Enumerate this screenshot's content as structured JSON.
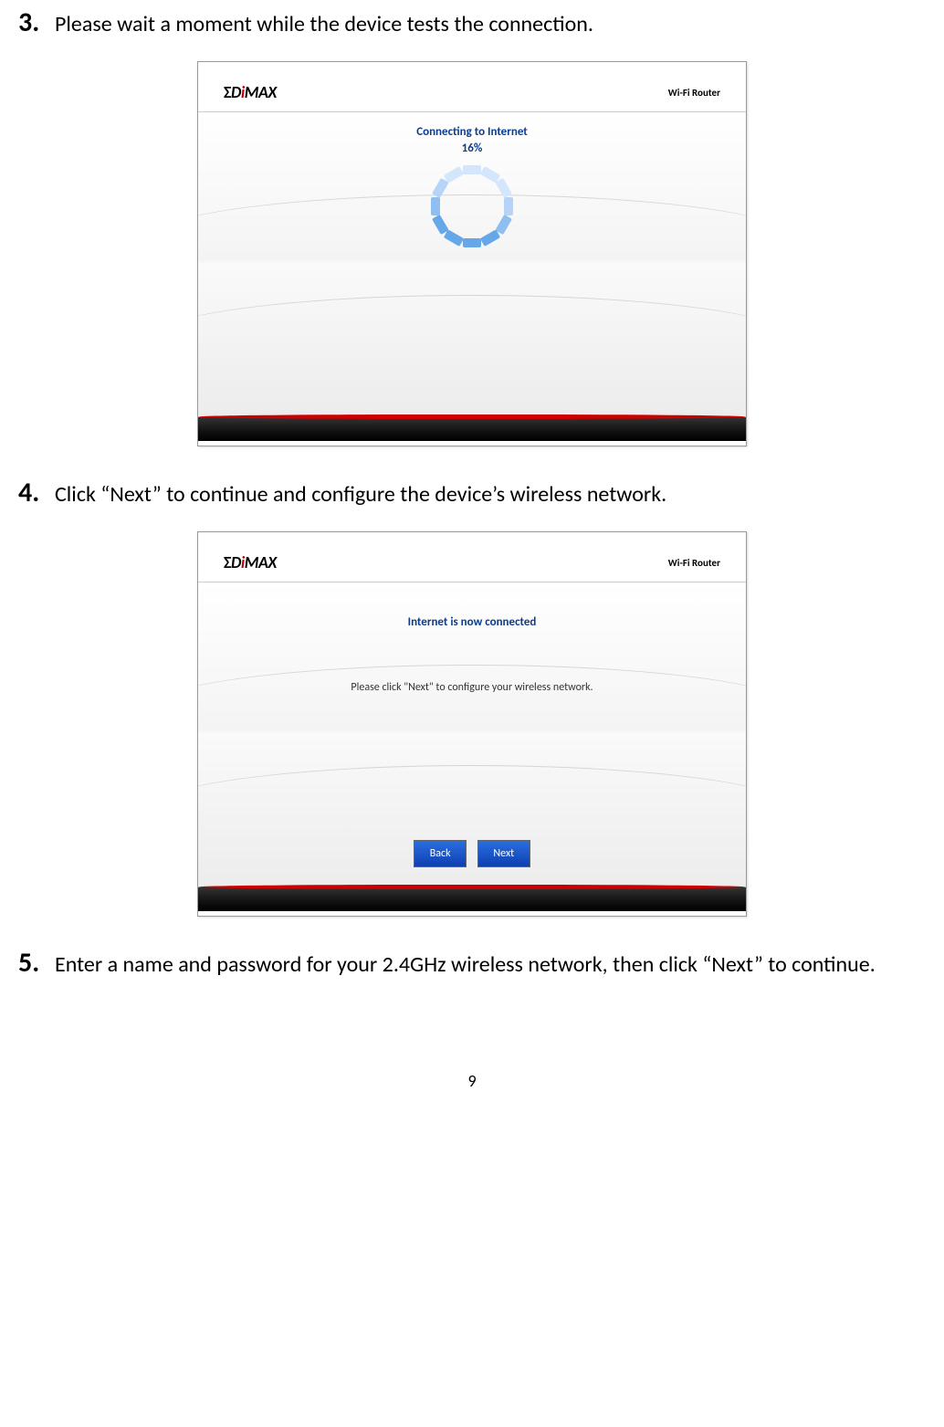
{
  "steps": {
    "s3": {
      "num": "3.",
      "text": "Please wait a moment while the device tests the connection."
    },
    "s4": {
      "num": "4.",
      "text": "Click “Next” to continue and configure the device’s wireless network."
    },
    "s5": {
      "num": "5.",
      "text": "Enter a name and password for your 2.4GHz wireless network, then click “Next” to continue."
    }
  },
  "screenshot1": {
    "logo": "ΣDiMAX",
    "mode": "Wi-Fi Router",
    "connecting": "Connecting to Internet",
    "percent": "16%"
  },
  "screenshot2": {
    "logo": "ΣDiMAX",
    "mode": "Wi-Fi Router",
    "status": "Internet is now connected",
    "sub": "Please click \"Next\" to configure your wireless network.",
    "back": "Back",
    "next": "Next"
  },
  "page_number": "9"
}
